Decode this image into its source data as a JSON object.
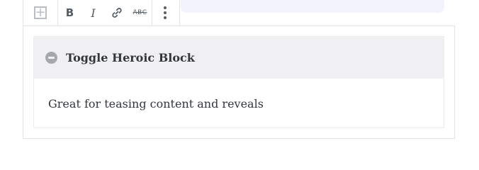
{
  "toolbar": {
    "add_icon": "plus-square-icon",
    "bold_label": "B",
    "italic_label": "I",
    "link_icon": "link-icon",
    "strike_label": "ABC",
    "more_icon": "vertical-ellipsis-icon"
  },
  "block": {
    "toggle_icon": "minus-circle-icon",
    "title": "Toggle Heroic Block",
    "content": "Great for teasing content and reveals"
  },
  "colors": {
    "header_bg": "#f0f0f3",
    "accent_strip": "#f1f5fb",
    "text": "#32373c"
  }
}
